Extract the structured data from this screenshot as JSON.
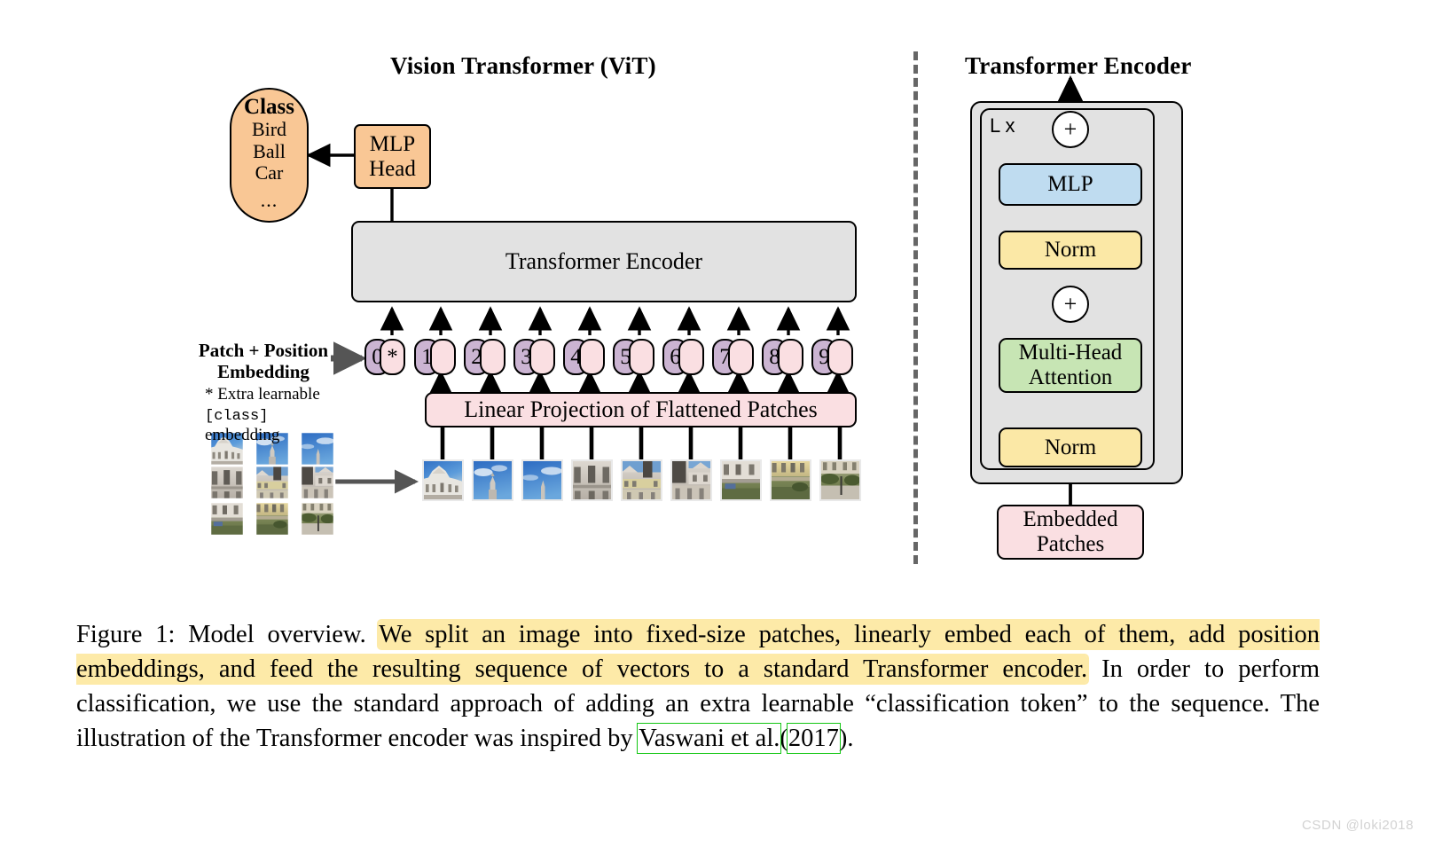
{
  "figure": {
    "left_panel_title": "Vision Transformer (ViT)",
    "right_panel_title": "Transformer Encoder"
  },
  "vit": {
    "class_head": {
      "title": "Class",
      "items": [
        "Bird",
        "Ball",
        "Car"
      ],
      "ellipsis": "..."
    },
    "mlp_head": "MLP\nHead",
    "mlp_head_line1": "MLP",
    "mlp_head_line2": "Head",
    "encoder_box": "Transformer Encoder",
    "embedding_label_line1": "Patch + Position",
    "embedding_label_line2": "Embedding",
    "extra_note_line1": "* Extra learnable",
    "extra_note_mono": "[class]",
    "extra_note_tail": " embedding",
    "linear_projection": "Linear Projection of Flattened Patches",
    "tokens": [
      {
        "index": "0",
        "star": "*"
      },
      {
        "index": "1"
      },
      {
        "index": "2"
      },
      {
        "index": "3"
      },
      {
        "index": "4"
      },
      {
        "index": "5"
      },
      {
        "index": "6"
      },
      {
        "index": "7"
      },
      {
        "index": "8"
      },
      {
        "index": "9"
      }
    ]
  },
  "encoder": {
    "repeat_label": "L x",
    "blocks": {
      "mlp": "MLP",
      "norm_top": "Norm",
      "attention_line1": "Multi-Head",
      "attention_line2": "Attention",
      "norm_bottom": "Norm",
      "embedded_patches_line1": "Embedded",
      "embedded_patches_line2": "Patches"
    },
    "add_symbol": "+"
  },
  "caption": {
    "prefix": "Figure 1: Model overview.",
    "highlight": "We split an image into fixed-size patches, linearly embed each of them, add position embeddings, and feed the resulting sequence of vectors to a standard Transformer encoder.",
    "rest_1": "In order to perform classification, we use the standard approach of adding an extra learnable “classification token” to the sequence. The illustration of the Transformer encoder was inspired by",
    "citation_author": "Vaswani et al.",
    "citation_open": "(",
    "citation_year": "2017",
    "citation_close": ")."
  },
  "watermark": "CSDN @loki2018",
  "colors": {
    "orange": "#f9c795",
    "gray": "#e2e2e2",
    "pink": "#fadfe2",
    "blue": "#bfdcf0",
    "yellow": "#fbe8a6",
    "green": "#c7e5b4",
    "purple": "#cbb4d2",
    "highlight": "#fdeaa8",
    "citation_box": "#13c713"
  }
}
